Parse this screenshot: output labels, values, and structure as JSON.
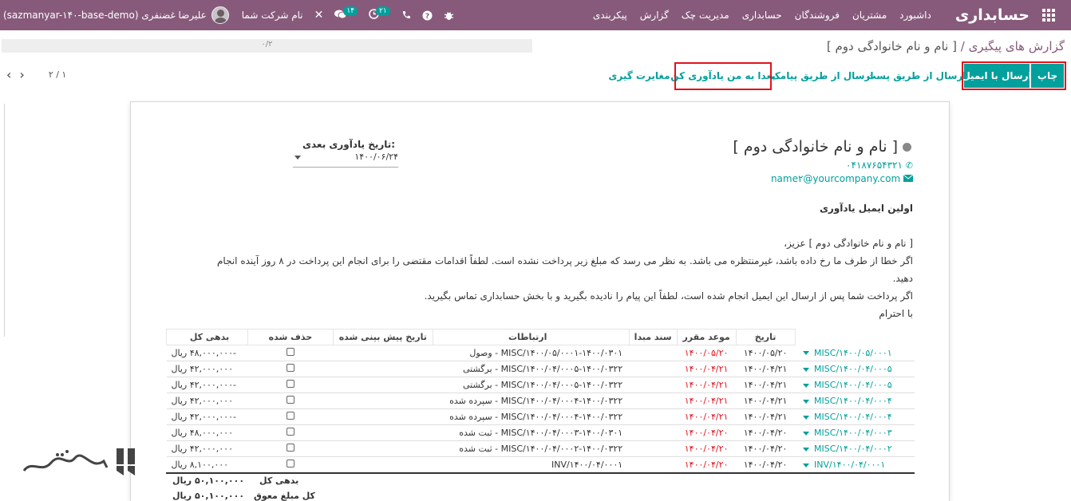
{
  "navbar": {
    "brand": "حسابداری",
    "menu": [
      "داشبورد",
      "مشتریان",
      "فروشندگان",
      "حسابداری",
      "مدیریت چک",
      "گزارش",
      "پیکربندی"
    ],
    "db_user": "(sazmanyar-۱۴۰-base-demo) علیرضا غضنفری",
    "company": "نام شرکت شما",
    "msg_count": "۱۴",
    "activity_count": "۲۱"
  },
  "breadcrumb": {
    "parent": "گزارش های پیگیری",
    "separator": "/",
    "current": "[ نام و نام خانوادگی دوم ]"
  },
  "progress_text": "۰/۲",
  "pager": {
    "value": "۲ / ۱"
  },
  "buttons": {
    "print": "چاپ",
    "send_email": "ارسال با ایمیل",
    "send_post": "ارسال از طریق پست",
    "send_sms": "ارسال از طریق پیامک",
    "remind_later": "بعدا به من یادآوری کن",
    "mismatch": "مغایرت گیری"
  },
  "partner": {
    "name": "[ نام و نام خانوادگی دوم ]",
    "phone": "۰۴۱۸۷۶۵۴۳۲۱",
    "email": "name۲@yourcompany.com"
  },
  "next_reminder": {
    "label": "تاریخ یادآوری بعدی:",
    "value": "۱۴۰۰/۰۶/۲۴"
  },
  "level_title": "اولین ایمیل یادآوری",
  "letter": [
    "[ نام و نام خانوادگی دوم ] عزیز،",
    "اگر خطا از طرف ما رخ داده باشد، غیرمنتظره می باشد. به نظر می رسد که مبلغ زیر پرداخت نشده است. لطفاً اقدامات مقتضی را برای انجام این پرداخت در ۸ روز آینده انجام دهید.",
    "اگر پرداخت شما پس از ارسال این ایمیل انجام شده است، لطفاً این پیام را نادیده بگیرید و با بخش حسابداری تماس بگیرید.",
    "با احترام"
  ],
  "table": {
    "headers": {
      "date": "تاریخ",
      "due": "موعد مقرر",
      "origin": "سند مبدا",
      "comm": "ارتباطات",
      "expected": "تاریخ پیش بینی شده",
      "blocked": "حذف شده",
      "total": "بدهی کل"
    },
    "rows": [
      {
        "ref": "MISC/۱۴۰۰/۰۵/۰۰۰۱",
        "date": "۱۴۰۰/۰۵/۲۰",
        "due": "۱۴۰۰/۰۵/۲۰",
        "comm": "MISC/۱۴۰۰/۰۵/۰۰۰۱-۱۴۰۰/۰۳۰۱ - وصول",
        "amount": "-۴۸,۰۰۰,۰۰۰ ریال"
      },
      {
        "ref": "MISC/۱۴۰۰/۰۴/۰۰۰۵",
        "date": "۱۴۰۰/۰۴/۲۱",
        "due": "۱۴۰۰/۰۴/۲۱",
        "comm": "MISC/۱۴۰۰/۰۴/۰۰۰۵-۱۴۰۰/۰۳۲۲ - برگشتی",
        "amount": "۴۲,۰۰۰,۰۰۰ ریال"
      },
      {
        "ref": "MISC/۱۴۰۰/۰۴/۰۰۰۵",
        "date": "۱۴۰۰/۰۴/۲۱",
        "due": "۱۴۰۰/۰۴/۲۱",
        "comm": "MISC/۱۴۰۰/۰۴/۰۰۰۵-۱۴۰۰/۰۳۲۲ - برگشتی",
        "amount": "-۴۲,۰۰۰,۰۰۰ ریال"
      },
      {
        "ref": "MISC/۱۴۰۰/۰۴/۰۰۰۴",
        "date": "۱۴۰۰/۰۴/۲۱",
        "due": "۱۴۰۰/۰۴/۲۱",
        "comm": "MISC/۱۴۰۰/۰۴/۰۰۰۴-۱۴۰۰/۰۳۲۲ - سپرده شده",
        "amount": "۴۲,۰۰۰,۰۰۰ ریال"
      },
      {
        "ref": "MISC/۱۴۰۰/۰۴/۰۰۰۴",
        "date": "۱۴۰۰/۰۴/۲۱",
        "due": "۱۴۰۰/۰۴/۲۱",
        "comm": "MISC/۱۴۰۰/۰۴/۰۰۰۴-۱۴۰۰/۰۳۲۲ - سپرده شده",
        "amount": "-۴۲,۰۰۰,۰۰۰ ریال"
      },
      {
        "ref": "MISC/۱۴۰۰/۰۴/۰۰۰۳",
        "date": "۱۴۰۰/۰۴/۲۰",
        "due": "۱۴۰۰/۰۴/۲۰",
        "comm": "MISC/۱۴۰۰/۰۴/۰۰۰۳-۱۴۰۰/۰۳۰۱ - ثبت شده",
        "amount": "۴۸,۰۰۰,۰۰۰ ریال"
      },
      {
        "ref": "MISC/۱۴۰۰/۰۴/۰۰۰۲",
        "date": "۱۴۰۰/۰۴/۲۰",
        "due": "۱۴۰۰/۰۴/۲۰",
        "comm": "MISC/۱۴۰۰/۰۴/۰۰۰۲-۱۴۰۰/۰۳۲۲ - ثبت شده",
        "amount": "۴۲,۰۰۰,۰۰۰ ریال"
      },
      {
        "ref": "INV/۱۴۰۰/۰۴/۰۰۰۱",
        "date": "۱۴۰۰/۰۴/۲۰",
        "due": "۱۴۰۰/۰۴/۲۰",
        "comm": "INV/۱۴۰۰/۰۴/۰۰۰۱",
        "amount": "۸,۱۰۰,۰۰۰ ریال"
      }
    ],
    "total_label": "بدهی کل",
    "total_value": "۵۰,۱۰۰,۰۰۰ ریال",
    "overdue_label": "کل مبلغ معوق",
    "overdue_value": "۵۰,۱۰۰,۰۰۰ ریال"
  },
  "colors": {
    "navbar": "#875A7B",
    "primary": "#00A09D",
    "highlight": "#e3121b"
  }
}
